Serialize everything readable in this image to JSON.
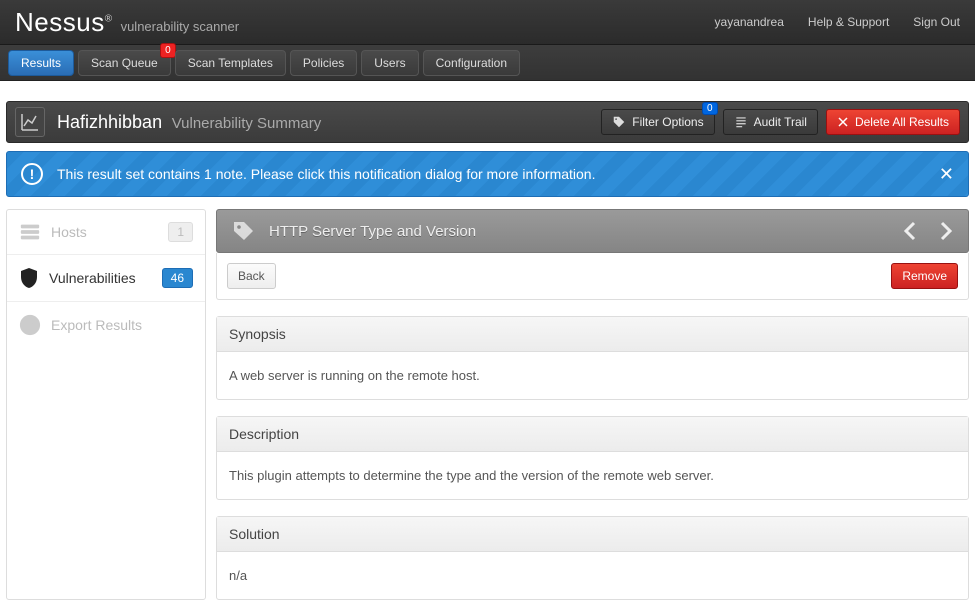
{
  "brand": {
    "name": "Nessus",
    "sub": "vulnerability scanner"
  },
  "user": {
    "name": "yayanandrea",
    "help": "Help & Support",
    "signout": "Sign Out"
  },
  "nav": {
    "results": "Results",
    "scan_queue": "Scan Queue",
    "scan_queue_badge": "0",
    "scan_templates": "Scan Templates",
    "policies": "Policies",
    "users": "Users",
    "configuration": "Configuration"
  },
  "header": {
    "title": "Hafizhhibban",
    "subtitle": "Vulnerability Summary",
    "filter": "Filter Options",
    "filter_badge": "0",
    "audit": "Audit Trail",
    "delete": "Delete All Results"
  },
  "alert": {
    "text": "This result set contains 1 note. Please click this notification dialog for more information."
  },
  "sidebar": {
    "hosts": {
      "label": "Hosts",
      "count": "1"
    },
    "vulns": {
      "label": "Vulnerabilities",
      "count": "46"
    },
    "export": {
      "label": "Export Results"
    }
  },
  "crumb": {
    "title": "HTTP Server Type and Version"
  },
  "actions": {
    "back": "Back",
    "remove": "Remove"
  },
  "panels": {
    "synopsis": {
      "title": "Synopsis",
      "body": "A web server is running on the remote host."
    },
    "description": {
      "title": "Description",
      "body": "This plugin attempts to determine the type and the version of the remote web server."
    },
    "solution": {
      "title": "Solution",
      "body": "n/a"
    }
  }
}
